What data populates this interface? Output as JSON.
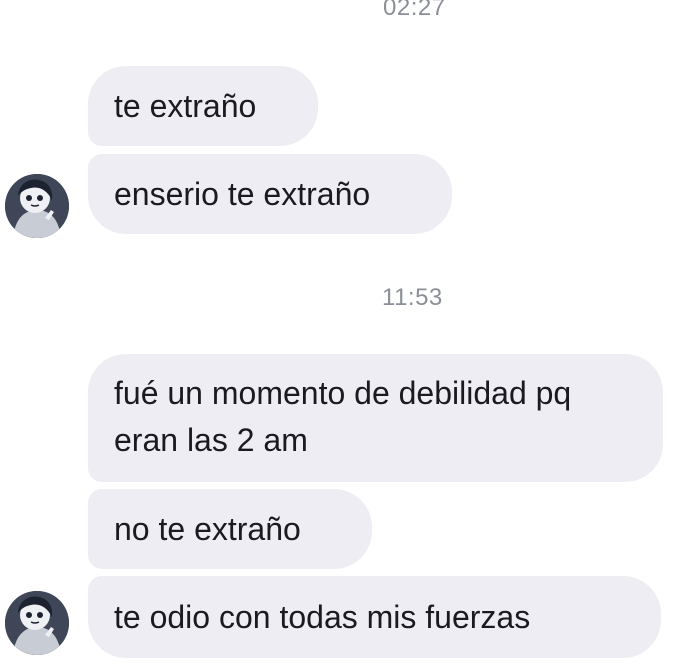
{
  "conversation": {
    "timestamps": [
      "02:27",
      "11:53"
    ],
    "group1": {
      "messages": [
        "te extraño",
        "enserio te extraño"
      ]
    },
    "group2": {
      "messages": [
        "fué un momento de debilidad pq eran las 2 am",
        "no te extraño",
        "te odio con todas mis fuerzas"
      ]
    },
    "avatar": {
      "icon": "cartoon-girl-avatar-icon"
    }
  },
  "colors": {
    "bubble_background": "#ededf3",
    "timestamp_text": "#8b8f97",
    "message_text": "#1b1b1f",
    "background": "#ffffff"
  }
}
